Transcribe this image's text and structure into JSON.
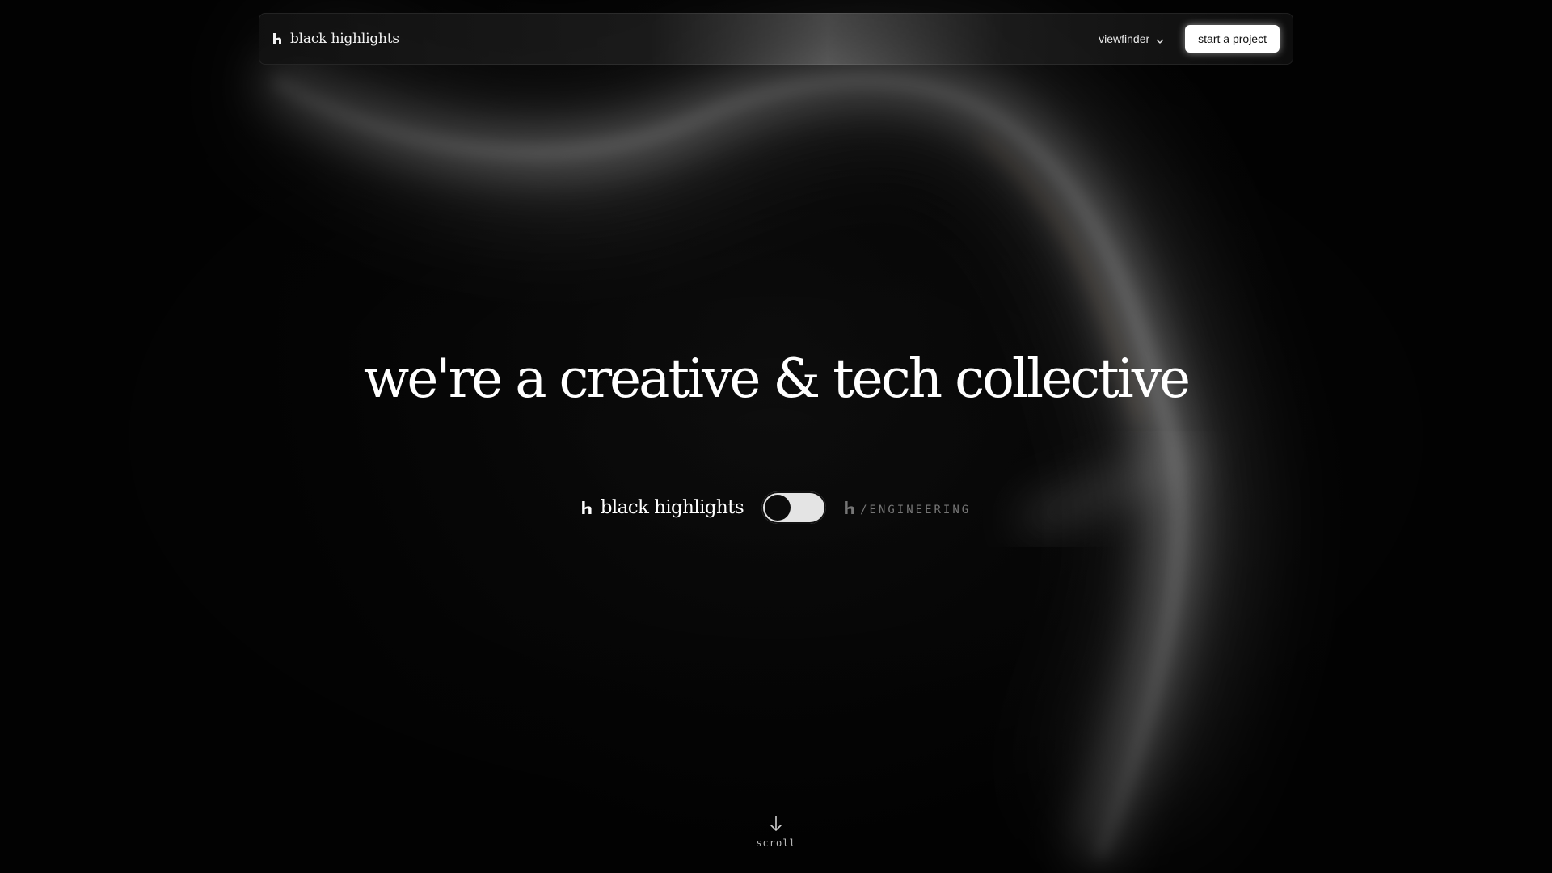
{
  "nav": {
    "brand": "black highlights",
    "dropdown_label": "viewfinder",
    "cta_label": "start a project"
  },
  "hero": {
    "title": "we're a creative & tech collective"
  },
  "toggle": {
    "left_brand": "black highlights",
    "right_label": "/ENGINEERING",
    "state": "off"
  },
  "scroll": {
    "label": "scroll"
  },
  "icons": {
    "brand": "bh-logo-icon",
    "dropdown": "chevron-down-icon",
    "scroll": "arrow-down-icon"
  },
  "colors": {
    "background": "#050505",
    "text": "#ffffff",
    "cta_bg": "#ffffff",
    "toggle_track": "#e4e4e4",
    "toggle_knob": "#0b0b0b"
  }
}
